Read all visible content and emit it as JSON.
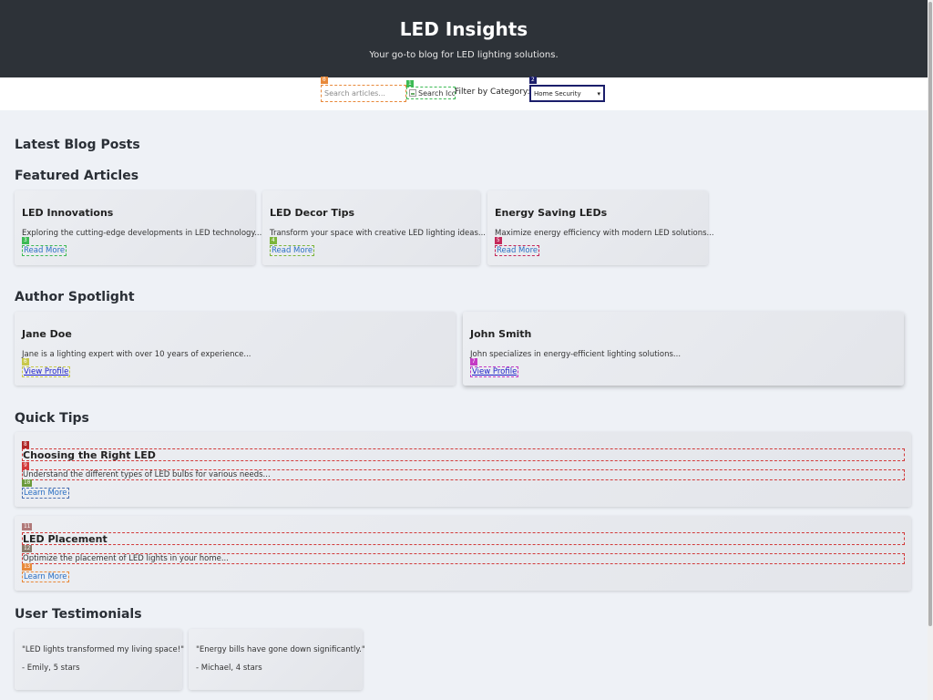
{
  "header": {
    "title": "LED Insights",
    "tagline": "Your go-to blog for LED lighting solutions."
  },
  "search": {
    "placeholder": "Search articles...",
    "button_label": "Search Icon",
    "filter_label": "Filter by Category:",
    "category_selected": "Home Security"
  },
  "sections": {
    "latest": "Latest Blog Posts",
    "featured": "Featured Articles",
    "authors": "Author Spotlight",
    "tips": "Quick Tips",
    "testimonials": "User Testimonials"
  },
  "featured": [
    {
      "title": "LED Innovations",
      "excerpt": "Exploring the cutting-edge developments in LED technology...",
      "link": "Read More"
    },
    {
      "title": "LED Decor Tips",
      "excerpt": "Transform your space with creative LED lighting ideas...",
      "link": "Read More"
    },
    {
      "title": "Energy Saving LEDs",
      "excerpt": "Maximize energy efficiency with modern LED solutions...",
      "link": "Read More"
    }
  ],
  "authors": [
    {
      "name": "Jane Doe",
      "bio": "Jane is a lighting expert with over 10 years of experience...",
      "link": "View Profile"
    },
    {
      "name": "John Smith",
      "bio": "John specializes in energy-efficient lighting solutions...",
      "link": "View Profile"
    }
  ],
  "tips": [
    {
      "title": "Choosing the Right LED",
      "text": "Understand the different types of LED bulbs for various needs...",
      "link": "Learn More"
    },
    {
      "title": "LED Placement",
      "text": "Optimize the placement of LED lights in your home...",
      "link": "Learn More"
    }
  ],
  "testimonials": [
    {
      "quote": "\"LED lights transformed my living space!\"",
      "author": "- Emily, 5 stars"
    },
    {
      "quote": "\"Energy bills have gone down significantly.\"",
      "author": "- Michael, 4 stars"
    }
  ],
  "badges": [
    "0",
    "1",
    "2",
    "3",
    "4",
    "5",
    "6",
    "7",
    "8",
    "9",
    "10",
    "11",
    "12",
    "13"
  ],
  "colors": {
    "header_bg": "#2d3238",
    "link": "#2a6fc4",
    "profile_link": "#1a1ec8",
    "page_bg": "#eef1f6"
  }
}
